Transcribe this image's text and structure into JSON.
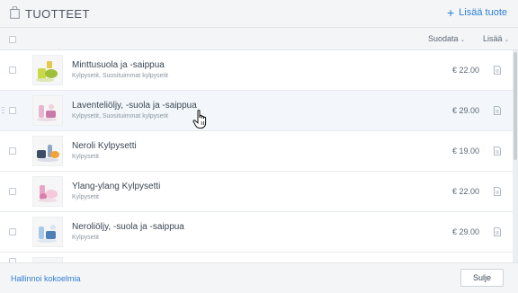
{
  "header": {
    "title": "TUOTTEET",
    "add_label": "Lisää tuote"
  },
  "toolbar": {
    "filter_label": "Suodata",
    "more_label": "Lisää"
  },
  "products": [
    {
      "name": "Minttusuola ja -saippua",
      "categories": "Kylpysetit, Suosituimmat kylpysetit",
      "price": "€ 22.00"
    },
    {
      "name": "Laventeliöljy, -suola ja -saippua",
      "categories": "Kylpysetit, Suosituimmat kylpysetit",
      "price": "€ 29.00"
    },
    {
      "name": "Neroli Kylpysetti",
      "categories": "Kylpysetit",
      "price": "€ 19.00"
    },
    {
      "name": "Ylang-ylang Kylpysetti",
      "categories": "Kylpysetit",
      "price": "€ 22.00"
    },
    {
      "name": "Neroliöljy, -suola ja -saippua",
      "categories": "Kylpysetit",
      "price": "€ 29.00"
    }
  ],
  "footer": {
    "manage_label": "Hallinnoi kokoelmia",
    "close_label": "Sulje"
  },
  "colors": {
    "accent": "#2d7fd6"
  },
  "icons": {
    "header": "shopping-bag-icon",
    "row_action": "document-icon",
    "cursor": "hand-pointer-icon"
  }
}
